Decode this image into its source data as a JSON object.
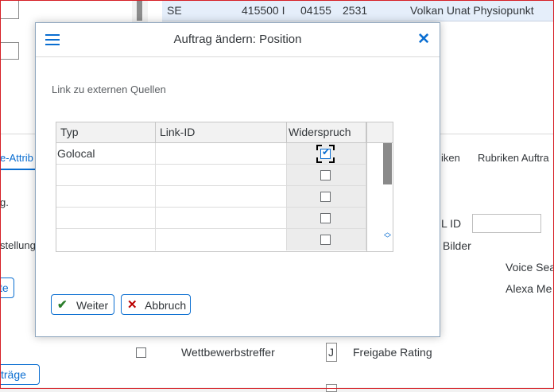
{
  "background": {
    "top_row": {
      "country": "SE",
      "number": "415500 I",
      "code": "04155",
      "nr": "2531",
      "name": "Volkan Unat Physiopunkt"
    },
    "tabs": {
      "left_tab": "e-Attrib",
      "rubriken": "iken",
      "rubriken_auftrag": "Rubriken Auftra"
    },
    "texts": {
      "g": "g.",
      "stellung": "stellung",
      "id_label": "L ID",
      "bilder": "Bilder",
      "voice": "Voice Sea",
      "alexa": "Alexa Me",
      "wettbewerb": "Wettbewerbstreffer",
      "freigabe": "Freigabe Rating",
      "j_value": "J"
    },
    "buttons": {
      "te": "te",
      "trage": "träge"
    }
  },
  "dialog": {
    "title": "Auftrag ändern: Position",
    "section_label": "Link zu externen Quellen",
    "table": {
      "columns": [
        "Typ",
        "Link-ID",
        "Widerspruch"
      ],
      "rows": [
        {
          "typ": "Golocal",
          "link_id": "",
          "widerspruch": true
        },
        {
          "typ": "",
          "link_id": "",
          "widerspruch": false
        },
        {
          "typ": "",
          "link_id": "",
          "widerspruch": false
        },
        {
          "typ": "",
          "link_id": "",
          "widerspruch": false
        },
        {
          "typ": "",
          "link_id": "",
          "widerspruch": false
        }
      ]
    },
    "buttons": {
      "ok_label": "Weiter",
      "ok_icon": "checkmark-icon",
      "cancel_label": "Abbruch",
      "cancel_icon": "cross-icon"
    }
  },
  "colors": {
    "accent": "#0a6ed1",
    "ok": "#2b7d2b",
    "cancel": "#bb0000",
    "frame": "#d61f26"
  }
}
